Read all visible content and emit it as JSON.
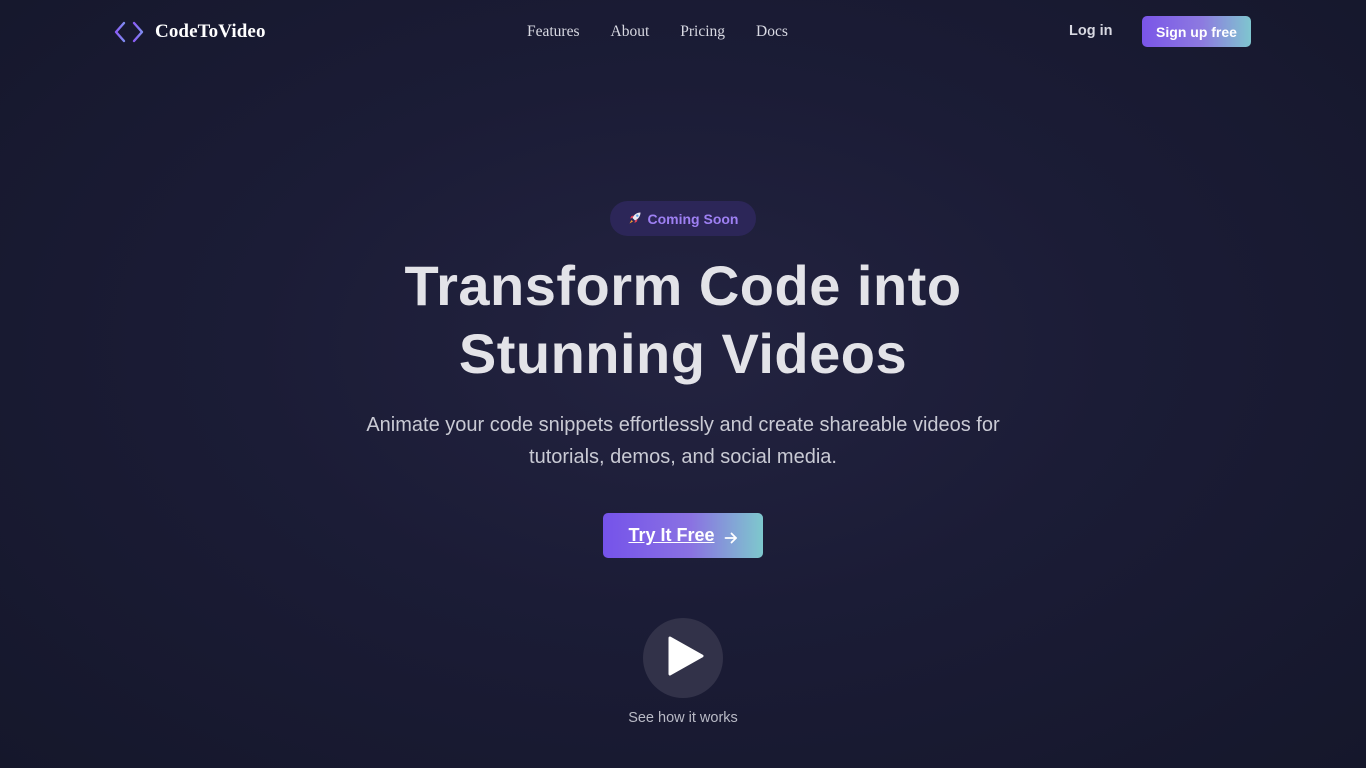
{
  "brand": {
    "name": "CodeToVideo",
    "icon": "code-brackets-icon",
    "accent": "#8b5cf6"
  },
  "nav": {
    "links": [
      "Features",
      "About",
      "Pricing",
      "Docs"
    ],
    "login_label": "Log in",
    "signup_label": "Sign up free"
  },
  "hero": {
    "badge_icon": "rocket-icon",
    "badge_text": "Coming Soon",
    "headline_line1": "Transform Code into",
    "headline_line2": "Stunning Videos",
    "subtitle": "Animate your code snippets effortlessly and create shareable videos for tutorials, demos, and social media.",
    "cta_label": "Try It Free",
    "cta_icon": "arrow-right-icon",
    "play_icon": "play-icon",
    "play_caption": "See how it works"
  },
  "colors": {
    "background": "#1b1c36",
    "gradient_start": "#7553ea",
    "gradient_end": "#7ec8cd",
    "badge_bg": "#2c2658",
    "badge_text": "#9e80f3"
  }
}
